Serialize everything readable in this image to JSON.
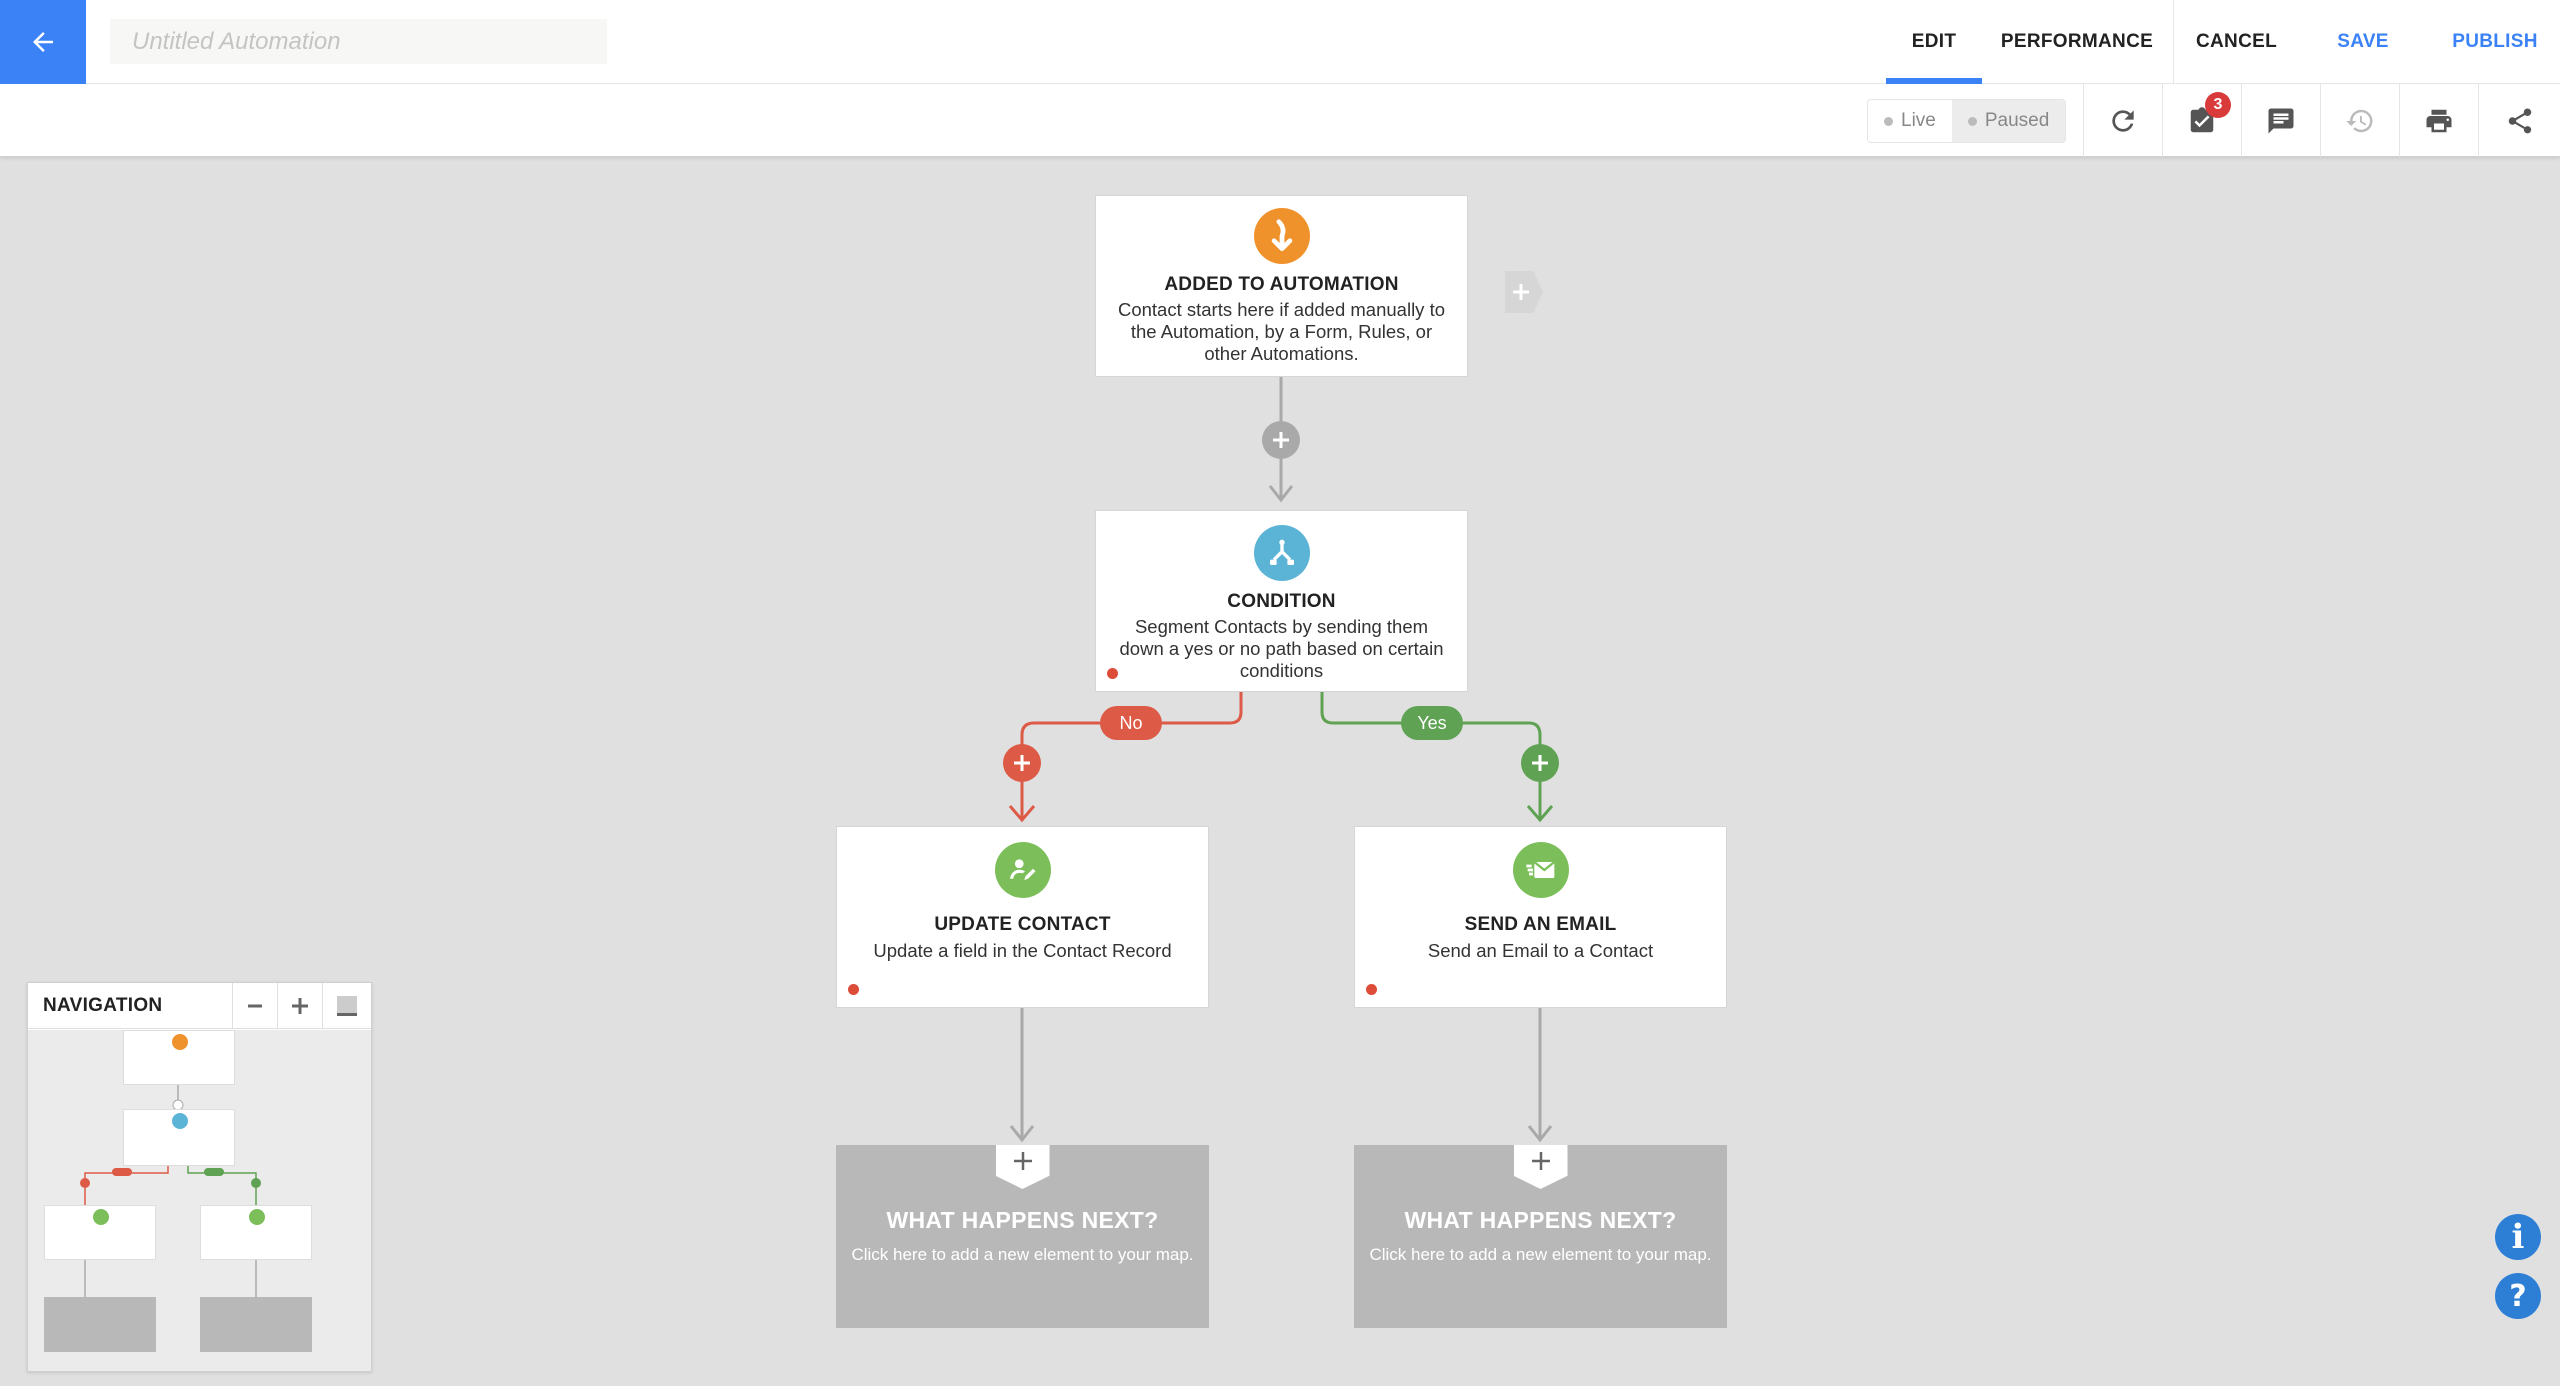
{
  "header": {
    "title_placeholder": "Untitled Automation",
    "nav": {
      "edit": "EDIT",
      "performance": "PERFORMANCE",
      "cancel": "CANCEL",
      "save": "SAVE",
      "publish": "PUBLISH"
    },
    "active_tab": "EDIT",
    "accent_color": "#3b82f6"
  },
  "toolbar": {
    "status_live": "Live",
    "status_paused": "Paused",
    "tasks_badge": "3",
    "icons": [
      "refresh-icon",
      "tasks-icon",
      "comment-icon",
      "history-icon",
      "print-icon",
      "share-icon"
    ]
  },
  "canvas": {
    "trigger": {
      "title": "ADDED TO AUTOMATION",
      "description": "Contact starts here if added manually to the Automation, by a Form, Rules, or other Automations.",
      "icon": "entry-arrow-icon",
      "color": "#f0922b"
    },
    "condition": {
      "title": "CONDITION",
      "description": "Segment Contacts by sending them down a yes or no path based on certain conditions",
      "icon": "branch-icon",
      "color": "#5bb4d6"
    },
    "no_label": "No",
    "yes_label": "Yes",
    "no_color": "#dd5a47",
    "yes_color": "#5fa253",
    "update_contact": {
      "title": "UPDATE CONTACT",
      "description": "Update a field in the Contact Record",
      "icon": "edit-contact-icon",
      "color": "#7cbf5a"
    },
    "send_email": {
      "title": "SEND AN EMAIL",
      "description": "Send an Email to a Contact",
      "icon": "email-icon",
      "color": "#7cbf5a"
    },
    "next_left": {
      "title": "WHAT HAPPENS NEXT?",
      "description": "Click here to add a new element to your map."
    },
    "next_right": {
      "title": "WHAT HAPPENS NEXT?",
      "description": "Click here to add a new element to your map."
    }
  },
  "navigation": {
    "title": "NAVIGATION",
    "zoom_out": "−",
    "zoom_in": "+"
  },
  "help": {
    "info": "i",
    "question": "?"
  }
}
